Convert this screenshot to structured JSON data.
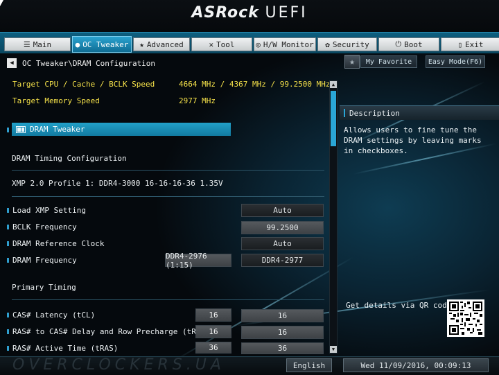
{
  "header": {
    "brand": "ASRock",
    "brand_suffix": "UEFI"
  },
  "tabs": [
    {
      "label": "Main",
      "icon": "list-icon"
    },
    {
      "label": "OC Tweaker",
      "icon": "flame-icon"
    },
    {
      "label": "Advanced",
      "icon": "star-icon"
    },
    {
      "label": "Tool",
      "icon": "tools-icon"
    },
    {
      "label": "H/W Monitor",
      "icon": "monitor-icon"
    },
    {
      "label": "Security",
      "icon": "shield-icon"
    },
    {
      "label": "Boot",
      "icon": "power-icon"
    },
    {
      "label": "Exit",
      "icon": "exit-icon"
    }
  ],
  "toolbar": {
    "favorite_label": "My Favorite",
    "easy_mode_label": "Easy Mode(F6)"
  },
  "breadcrumb": "OC Tweaker\\DRAM Configuration",
  "info": {
    "target_cpu_label": "Target CPU / Cache / BCLK Speed",
    "target_cpu_value": "4664 MHz / 4367 MHz / 99.2500 MHz",
    "target_mem_label": "Target Memory Speed",
    "target_mem_value": "2977 MHz"
  },
  "dram_tweaker_label": "DRAM Tweaker",
  "timing_config_label": "DRAM Timing Configuration",
  "xmp_profile": "XMP 2.0 Profile 1: DDR4-3000 16-16-16-36 1.35V",
  "settings": [
    {
      "label": "Load XMP Setting",
      "value": "Auto"
    },
    {
      "label": "BCLK Frequency",
      "value": "99.2500"
    },
    {
      "label": "DRAM Reference Clock",
      "value": "Auto"
    },
    {
      "label": "DRAM Frequency",
      "current": "DDR4-2976 (1:15)",
      "value": "DDR4-2977"
    }
  ],
  "primary_timing_label": "Primary Timing",
  "timings": [
    {
      "label": "CAS# Latency (tCL)",
      "current": "16",
      "value": "16"
    },
    {
      "label": "RAS# to CAS# Delay and Row Precharge (tRCDtRP)",
      "current": "16",
      "value": "16"
    },
    {
      "label": "RAS# Active Time (tRAS)",
      "current": "36",
      "value": "36"
    }
  ],
  "description": {
    "title": "Description",
    "text": "Allows users to fine tune the DRAM settings by leaving marks in checkboxes.",
    "qr_label": "Get details via QR code"
  },
  "footer": {
    "language": "English",
    "datetime": "Wed 11/09/2016, 00:09:13"
  },
  "colors": {
    "accent": "#2aa6d6",
    "highlight_text": "#f6e24a"
  }
}
